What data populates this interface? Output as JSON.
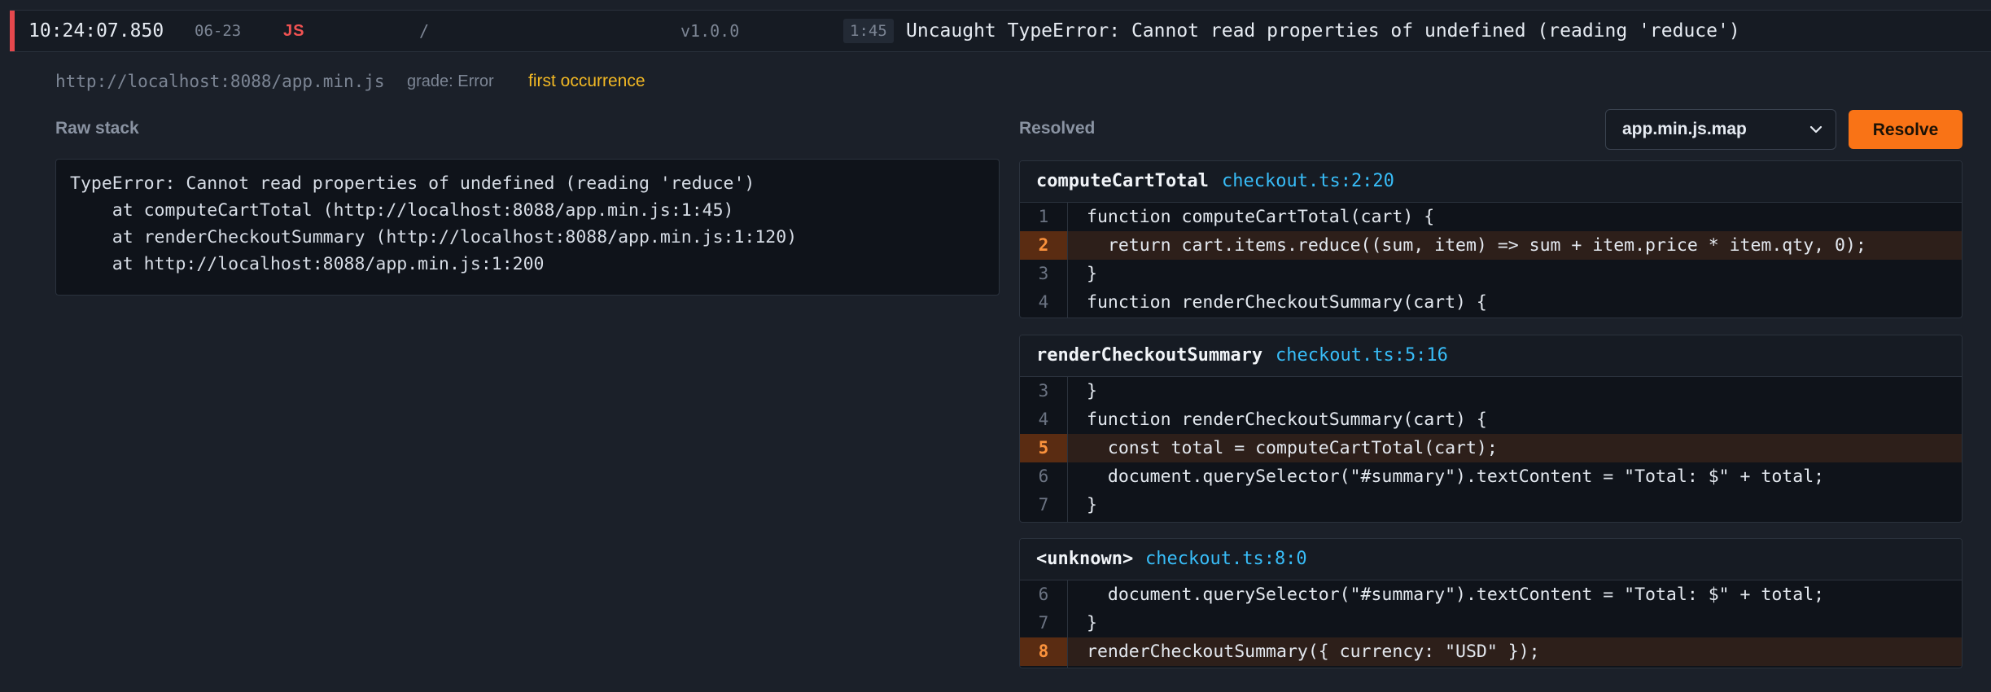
{
  "header": {
    "time": "10:24:07.850",
    "date": "06-23",
    "lang": "JS",
    "path": "/",
    "version": "v1.0.0",
    "position": "1:45",
    "message": "Uncaught TypeError: Cannot read properties of undefined (reading 'reduce')",
    "accent_color": "#e5484d"
  },
  "meta": {
    "url": "http://localhost:8088/app.min.js",
    "grade": "grade: Error",
    "occurrence": "first occurrence"
  },
  "raw": {
    "title": "Raw stack",
    "lines": [
      "TypeError: Cannot read properties of undefined (reading 'reduce')",
      "    at computeCartTotal (http://localhost:8088/app.min.js:1:45)",
      "    at renderCheckoutSummary (http://localhost:8088/app.min.js:1:120)",
      "    at http://localhost:8088/app.min.js:1:200"
    ]
  },
  "resolved": {
    "title": "Resolved",
    "map_select": "app.min.js.map",
    "resolve_label": "Resolve",
    "resolve_color": "#f97316",
    "frames": [
      {
        "fn": "computeCartTotal",
        "loc": "checkout.ts:2:20",
        "lines": [
          {
            "n": "1",
            "code": "function computeCartTotal(cart) {",
            "hl": false
          },
          {
            "n": "2",
            "code": "  return cart.items.reduce((sum, item) => sum + item.price * item.qty, 0);",
            "hl": true
          },
          {
            "n": "3",
            "code": "}",
            "hl": false
          },
          {
            "n": "4",
            "code": "function renderCheckoutSummary(cart) {",
            "hl": false
          }
        ]
      },
      {
        "fn": "renderCheckoutSummary",
        "loc": "checkout.ts:5:16",
        "lines": [
          {
            "n": "3",
            "code": "}",
            "hl": false
          },
          {
            "n": "4",
            "code": "function renderCheckoutSummary(cart) {",
            "hl": false
          },
          {
            "n": "5",
            "code": "  const total = computeCartTotal(cart);",
            "hl": true
          },
          {
            "n": "6",
            "code": "  document.querySelector(\"#summary\").textContent = \"Total: $\" + total;",
            "hl": false
          },
          {
            "n": "7",
            "code": "}",
            "hl": false
          }
        ]
      },
      {
        "fn": "<unknown>",
        "loc": "checkout.ts:8:0",
        "lines": [
          {
            "n": "6",
            "code": "  document.querySelector(\"#summary\").textContent = \"Total: $\" + total;",
            "hl": false
          },
          {
            "n": "7",
            "code": "}",
            "hl": false
          },
          {
            "n": "8",
            "code": "renderCheckoutSummary({ currency: \"USD\" });",
            "hl": true
          }
        ]
      }
    ]
  }
}
